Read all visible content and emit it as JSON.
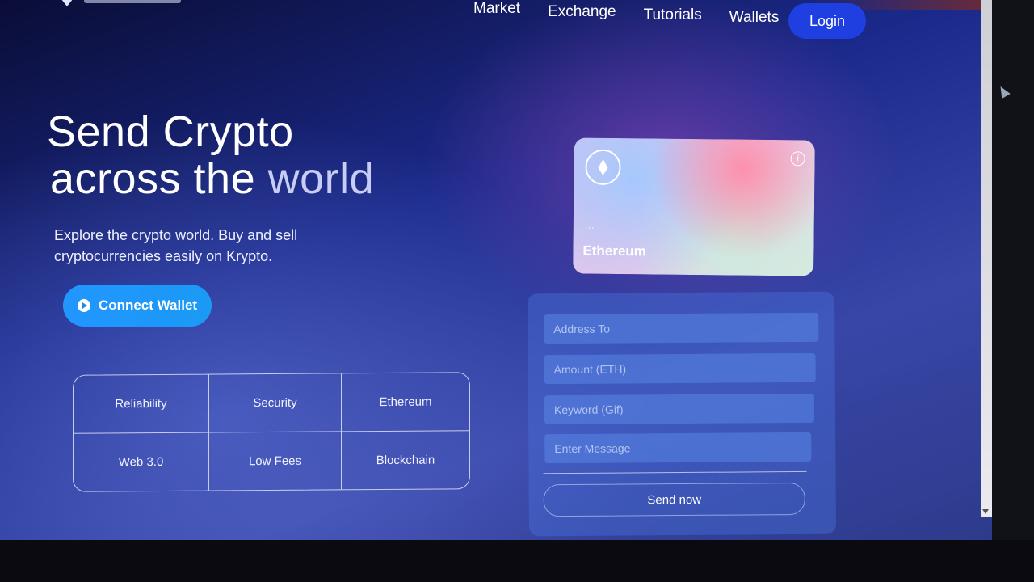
{
  "nav": {
    "links": [
      "Market",
      "Exchange",
      "Tutorials",
      "Wallets"
    ],
    "login_label": "Login"
  },
  "hero": {
    "title_line1": "Send Crypto",
    "title_line2_a": "across the",
    "title_line2_b": "world",
    "subtitle": "Explore the crypto world. Buy and sell cryptocurrencies easily on Krypto.",
    "connect_label": "Connect Wallet"
  },
  "features": [
    "Reliability",
    "Security",
    "Ethereum",
    "Web 3.0",
    "Low Fees",
    "Blockchain"
  ],
  "card": {
    "address": "...",
    "network": "Ethereum"
  },
  "form": {
    "address_placeholder": "Address To",
    "amount_placeholder": "Amount (ETH)",
    "keyword_placeholder": "Keyword (Gif)",
    "message_placeholder": "Enter Message",
    "submit_label": "Send now"
  },
  "colors": {
    "accent_blue": "#1f3fe0",
    "connect_blue": "#2196ff"
  }
}
